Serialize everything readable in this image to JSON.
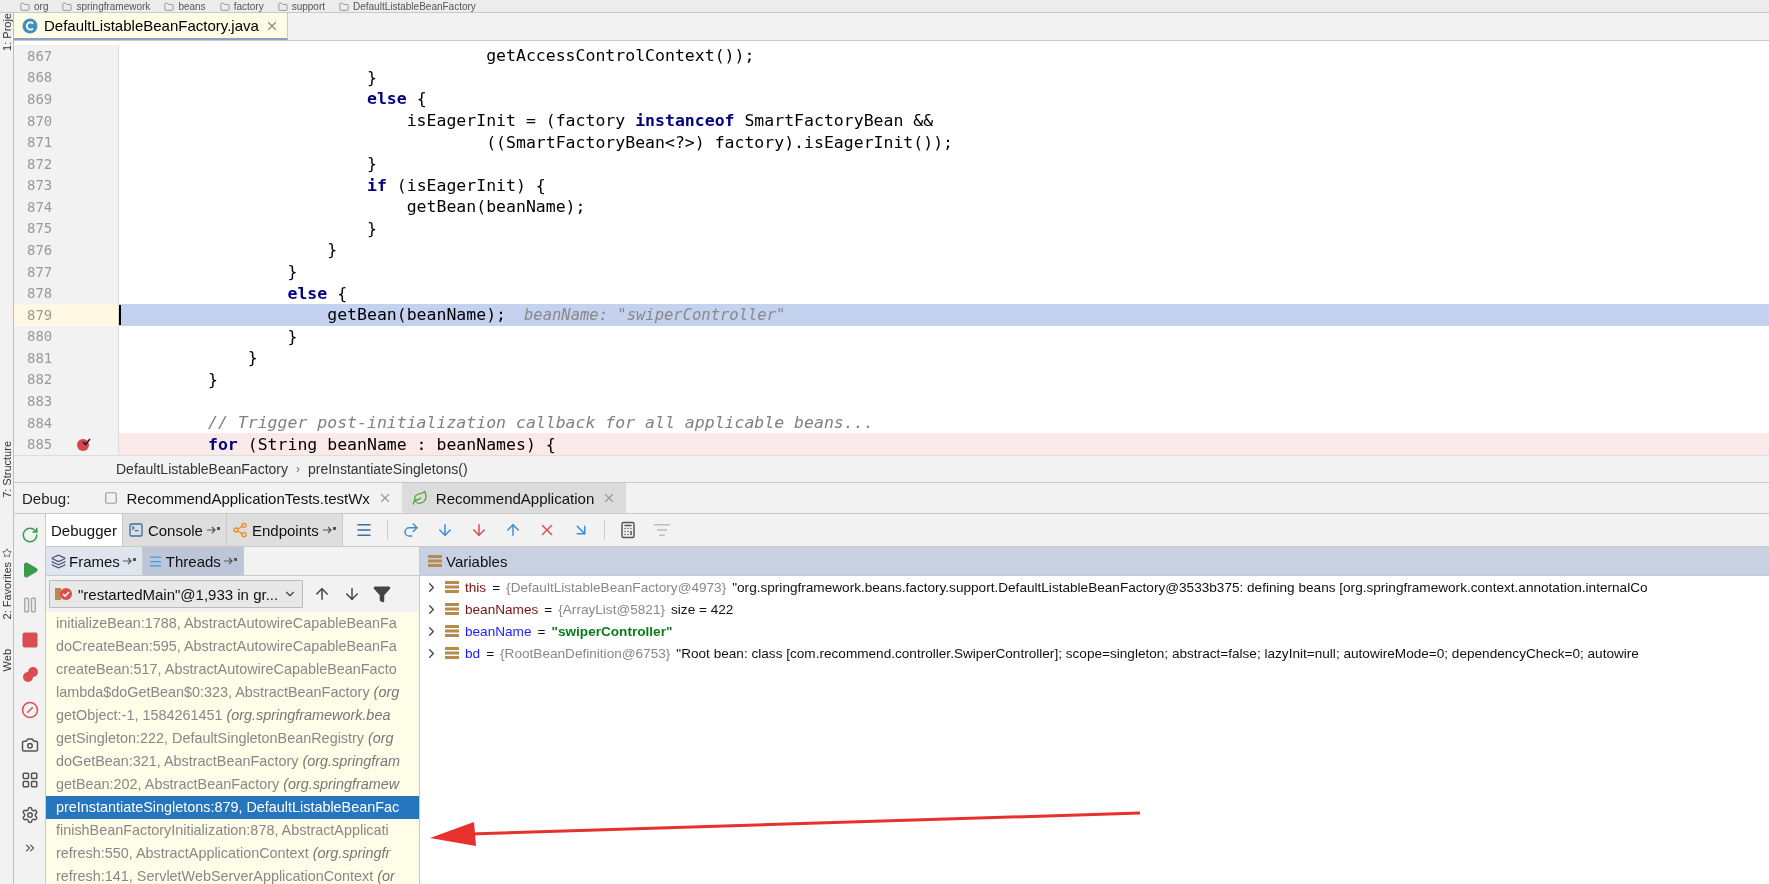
{
  "path_bar": [
    "org",
    "springframework",
    "beans",
    "factory",
    "support",
    "DefaultListableBeanFactory"
  ],
  "tool_strip": [
    {
      "label": "1: Proje"
    },
    {
      "label": "7: Structure"
    },
    {
      "label": "2: Favorites"
    },
    {
      "label": "Web"
    }
  ],
  "file_tab": {
    "title": "DefaultListableBeanFactory.java"
  },
  "editor": {
    "lines": [
      {
        "number": "867",
        "text": "                            getAccessControlContext());",
        "kind": "code",
        "current": false,
        "breakpoint": false
      },
      {
        "number": "868",
        "text": "                }",
        "kind": "code",
        "current": false,
        "breakpoint": false
      },
      {
        "number": "869",
        "text": "                **else** {",
        "kind": "code",
        "current": false,
        "breakpoint": false
      },
      {
        "number": "870",
        "text": "                    isEagerInit = (factory **instanceof** SmartFactoryBean &&",
        "kind": "code",
        "current": false,
        "breakpoint": false
      },
      {
        "number": "871",
        "text": "                            ((SmartFactoryBean<?>) factory).isEagerInit());",
        "kind": "code",
        "current": false,
        "breakpoint": false
      },
      {
        "number": "872",
        "text": "                }",
        "kind": "code",
        "current": false,
        "breakpoint": false
      },
      {
        "number": "873",
        "text": "                **if** (isEagerInit) {",
        "kind": "code",
        "current": false,
        "breakpoint": false
      },
      {
        "number": "874",
        "text": "                    getBean(beanName);",
        "kind": "code",
        "current": false,
        "breakpoint": false
      },
      {
        "number": "875",
        "text": "                }",
        "kind": "code",
        "current": false,
        "breakpoint": false
      },
      {
        "number": "876",
        "text": "            }",
        "kind": "code",
        "current": false,
        "breakpoint": false
      },
      {
        "number": "877",
        "text": "        }",
        "kind": "code",
        "current": false,
        "breakpoint": false
      },
      {
        "number": "878",
        "text": "        **else** {",
        "kind": "code",
        "current": false,
        "breakpoint": false
      },
      {
        "number": "879",
        "text": "            getBean(beanName);",
        "kind": "code",
        "current": true,
        "breakpoint": false,
        "hint": "beanName: \"swiperController\""
      },
      {
        "number": "880",
        "text": "        }",
        "kind": "code",
        "current": false,
        "breakpoint": false
      },
      {
        "number": "881",
        "text": "    }",
        "kind": "code",
        "current": false,
        "breakpoint": false
      },
      {
        "number": "882",
        "text": "}",
        "kind": "code",
        "current": false,
        "breakpoint": false
      },
      {
        "number": "883",
        "current": false,
        "breakpoint": false
      },
      {
        "number": "884",
        "text": "// Trigger post-initialization callback for all applicable beans...",
        "kind": "comment",
        "current": false,
        "breakpoint": false
      },
      {
        "number": "885",
        "text": "**for** (String beanName : beanNames) {",
        "kind": "code",
        "current": false,
        "breakpoint": true
      }
    ]
  },
  "editor_breadcrumb": [
    "DefaultListableBeanFactory",
    "›",
    "preInstantiateSingletons()"
  ],
  "debug": {
    "label": "Debug:",
    "sessions": [
      {
        "title": "RecommendApplicationTests.testWx",
        "kind": "test",
        "selected": false
      },
      {
        "title": "RecommendApplication",
        "kind": "spring",
        "selected": true
      }
    ],
    "tabs": [
      {
        "label": "Debugger",
        "kind": "debugger",
        "selected": true,
        "pinned": false
      },
      {
        "label": "Console",
        "kind": "console",
        "selected": false,
        "pinned": true
      },
      {
        "label": "Endpoints",
        "kind": "endpoints",
        "selected": false,
        "pinned": true
      }
    ],
    "frame_tabs": [
      {
        "label": "Frames",
        "kind": "frames",
        "selected": false
      },
      {
        "label": "Threads",
        "kind": "threads",
        "selected": true
      }
    ],
    "thread": "\"restartedMain\"@1,933 in gr...",
    "frames": [
      {
        "text": "initializeBean:1788, AbstractAutowireCapableBeanFa",
        "selected": false
      },
      {
        "text": "doCreateBean:595, AbstractAutowireCapableBeanFa",
        "selected": false
      },
      {
        "text": "createBean:517, AbstractAutowireCapableBeanFacto",
        "selected": false
      },
      {
        "text": "lambda$doGetBean$0:323, AbstractBeanFactory *(org*",
        "selected": false
      },
      {
        "text": "getObject:-1, 1584261451 *(org.springframework.bea*",
        "selected": false
      },
      {
        "text": "getSingleton:222, DefaultSingletonBeanRegistry *(org*",
        "selected": false
      },
      {
        "text": "doGetBean:321, AbstractBeanFactory *(org.springfram*",
        "selected": false
      },
      {
        "text": "getBean:202, AbstractBeanFactory *(org.springframew*",
        "selected": false
      },
      {
        "text": "preInstantiateSingletons:879, DefaultListableBeanFac",
        "selected": true
      },
      {
        "text": "finishBeanFactoryInitialization:878, AbstractApplicati",
        "selected": false
      },
      {
        "text": "refresh:550, AbstractApplicationContext *(org.springfr*",
        "selected": false
      },
      {
        "text": "refresh:141, ServletWebServerApplicationContext *(or*",
        "selected": false
      }
    ],
    "variables_title": "Variables",
    "variables": [
      {
        "name": "this",
        "operator": "=",
        "color": "#7a1010",
        "ref": "{DefaultListableBeanFactory@4973}",
        "value": "\"org.springframework.beans.factory.support.DefaultListableBeanFactory@3533b375: defining beans [org.springframework.context.annotation.internalCo",
        "kind": "object"
      },
      {
        "name": "beanNames",
        "operator": "=",
        "color": "#7a1010",
        "ref": "{ArrayList@5821}",
        "value": "size = 422",
        "kind": "object"
      },
      {
        "name": "beanName",
        "operator": "=",
        "color": "#1a1aff",
        "value": "\"swiperController\"",
        "kind": "string"
      },
      {
        "name": "bd",
        "operator": "=",
        "color": "#1a1aff",
        "ref": "{RootBeanDefinition@6753}",
        "value": "\"Root bean: class [com.recommend.controller.SwiperController]; scope=singleton; abstract=false; lazyInit=null; autowireMode=0; dependencyCheck=0; autowire",
        "kind": "object"
      }
    ]
  }
}
